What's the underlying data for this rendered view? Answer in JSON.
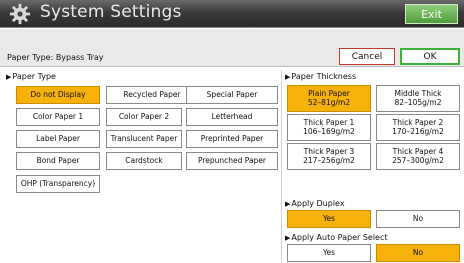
{
  "window": {
    "title": "System Settings",
    "exit_label": "Exit"
  },
  "header": {
    "subtitle": "Paper Type: Bypass Tray",
    "cancel_label": "Cancel",
    "ok_label": "OK"
  },
  "paper_type": {
    "label": "Paper Type",
    "buttons": [
      {
        "label": "Do not Display",
        "selected": true
      },
      {
        "label": "Recycled Paper",
        "selected": false
      },
      {
        "label": "Special Paper",
        "selected": false
      },
      {
        "label": "Color Paper 1",
        "selected": false
      },
      {
        "label": "Color Paper 2",
        "selected": false
      },
      {
        "label": "Letterhead",
        "selected": false
      },
      {
        "label": "Label Paper",
        "selected": false
      },
      {
        "label": "Translucent Paper",
        "selected": false
      },
      {
        "label": "Preprinted Paper",
        "selected": false
      },
      {
        "label": "Bond Paper",
        "selected": false
      },
      {
        "label": "Cardstock",
        "selected": false
      },
      {
        "label": "Prepunched Paper",
        "selected": false
      },
      {
        "label": "OHP (Transparency)",
        "selected": false
      }
    ]
  },
  "paper_thickness": {
    "label": "Paper Thickness",
    "buttons": [
      {
        "line1": "Plain Paper",
        "line2": "52–81g/m2",
        "selected": true
      },
      {
        "line1": "Middle Thick",
        "line2": "82–105g/m2",
        "selected": false
      },
      {
        "line1": "Thick Paper 1",
        "line2": "106–169g/m2",
        "selected": false
      },
      {
        "line1": "Thick Paper 2",
        "line2": "170–216g/m2",
        "selected": false
      },
      {
        "line1": "Thick Paper 3",
        "line2": "217–256g/m2",
        "selected": false
      },
      {
        "line1": "Thick Paper 4",
        "line2": "257–300g/m2",
        "selected": false
      }
    ]
  },
  "apply_duplex": {
    "label": "Apply Duplex",
    "yes": "Yes",
    "no": "No",
    "selected": "Yes"
  },
  "apply_auto_paper_select": {
    "label": "Apply Auto Paper Select",
    "yes": "Yes",
    "no": "No",
    "selected": "No"
  },
  "colors": {
    "selected": "#f6b10b",
    "cancel_border": "#c0392b",
    "ok_border": "#3bb33b",
    "exit": "#5fae48"
  }
}
